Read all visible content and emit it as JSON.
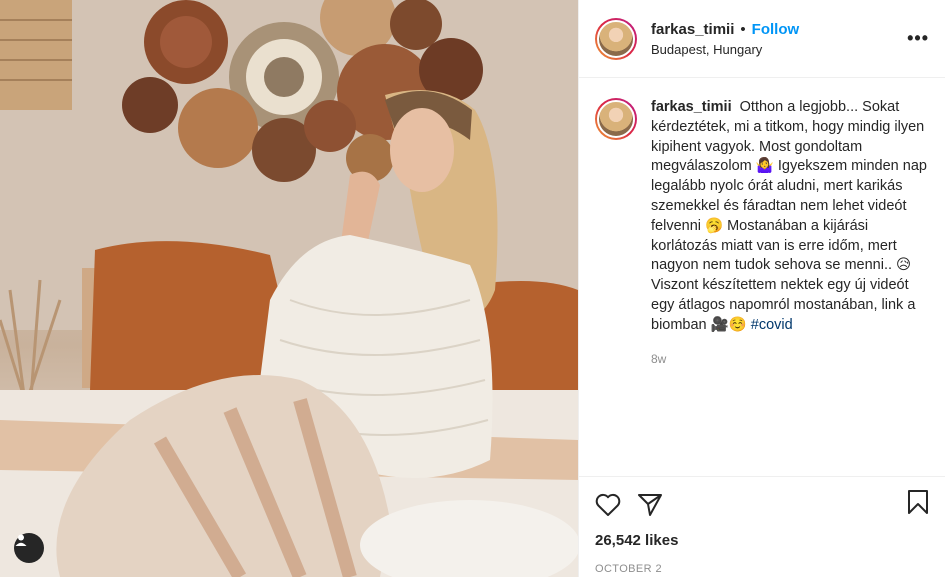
{
  "post": {
    "author": "farkas_timii",
    "follow_label": "Follow",
    "separator": "•",
    "location": "Budapest, Hungary",
    "more_label": "•••",
    "caption": "Otthon a legjobb... Sokat kérdeztétek, mi a titkom, hogy mindig ilyen kipihent vagyok. Most gondoltam megválaszolom 🤷‍♀️ Igyekszem minden nap legalább nyolc órát aludni, mert karikás szemekkel és fáradtan nem lehet videót felvenni 🥱 Mostanában a kijárási korlátozás miatt van is erre időm, mert nagyon nem tudok sehova se menni.. 😥 Viszont készítettem nektek egy új videót egy átlagos napomról mostanában, link a biomban 🎥☺️",
    "hashtag": "#covid",
    "age": "8w",
    "likes": "26,542 likes",
    "date": "OCTOBER 2"
  },
  "icons": {
    "like": "heart-outline-icon",
    "share": "paper-plane-icon",
    "save": "bookmark-icon",
    "tag": "user-tag-icon"
  },
  "colors": {
    "accent": "#0095f6",
    "hashtag": "#00376b",
    "muted": "#8e8e8e"
  }
}
